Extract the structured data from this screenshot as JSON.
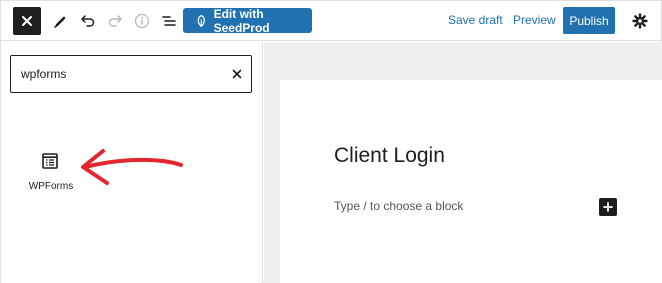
{
  "toolbar": {
    "seedprod_label": "Edit with SeedProd",
    "save_draft_label": "Save draft",
    "preview_label": "Preview",
    "publish_label": "Publish",
    "accent_color": "#2271b1",
    "icons": [
      "close-icon",
      "edit-tool-icon",
      "undo-icon",
      "redo-icon",
      "info-icon",
      "list-view-icon",
      "seedprod-leaf-icon",
      "settings-gear-icon"
    ]
  },
  "inserter": {
    "search_value": "wpforms",
    "results": [
      {
        "label": "WPForms",
        "icon": "wpforms-icon"
      }
    ],
    "annotation": "red-arrow"
  },
  "editor": {
    "title": "Client Login",
    "placeholder": "Type / to choose a block"
  }
}
